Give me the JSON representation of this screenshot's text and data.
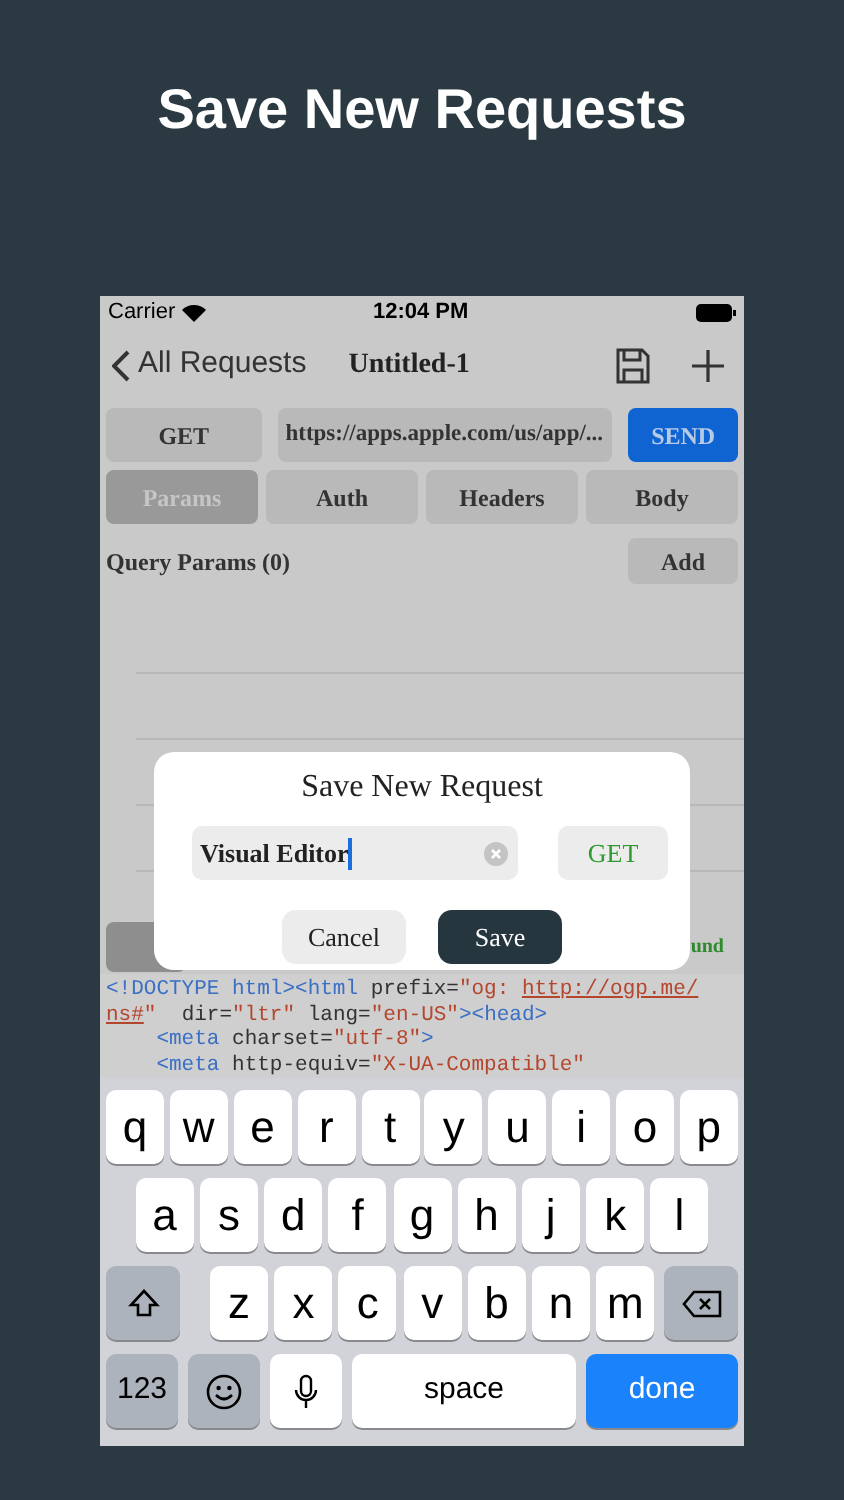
{
  "headline": "Save New Requests",
  "status_bar": {
    "carrier": "Carrier",
    "time": "12:04 PM"
  },
  "nav": {
    "back": "All Requests",
    "title": "Untitled-1"
  },
  "request": {
    "method": "GET",
    "url": "https://apps.apple.com/us/app/...",
    "send": "SEND"
  },
  "tabs": [
    {
      "label": "Params",
      "selected": true
    },
    {
      "label": "Auth",
      "selected": false
    },
    {
      "label": "Headers",
      "selected": false
    },
    {
      "label": "Body",
      "selected": false
    }
  ],
  "query_params": {
    "label": "Query Params (0)",
    "add": "Add"
  },
  "partial_status": "und",
  "code_lines": [
    [
      {
        "kind": "tag",
        "text": "<!DOCTYPE html><html "
      },
      {
        "kind": "attr",
        "text": "prefix="
      },
      {
        "kind": "value",
        "text": "\"og: "
      },
      {
        "kind": "link",
        "text": "http://ogp.me/"
      }
    ],
    [
      {
        "kind": "link",
        "text": "ns#"
      },
      {
        "kind": "value",
        "text": "\""
      },
      {
        "kind": "attr",
        "text": "  dir="
      },
      {
        "kind": "value",
        "text": "\"ltr\""
      },
      {
        "kind": "attr",
        "text": " lang="
      },
      {
        "kind": "value",
        "text": "\"en-US\""
      },
      {
        "kind": "tag",
        "text": "><head>"
      }
    ],
    [
      {
        "kind": "tag",
        "text": "    <meta "
      },
      {
        "kind": "attr",
        "text": "charset="
      },
      {
        "kind": "value",
        "text": "\"utf-8\""
      },
      {
        "kind": "tag",
        "text": ">"
      }
    ],
    [
      {
        "kind": "tag",
        "text": "    <meta "
      },
      {
        "kind": "attr",
        "text": "http-equiv="
      },
      {
        "kind": "value",
        "text": "\"X-UA-Compatible\""
      }
    ]
  ],
  "dialog": {
    "title": "Save New Request",
    "name_value": "Visual Editor",
    "method": "GET",
    "cancel": "Cancel",
    "save": "Save"
  },
  "keyboard": {
    "rows": [
      [
        "q",
        "w",
        "e",
        "r",
        "t",
        "y",
        "u",
        "i",
        "o",
        "p"
      ],
      [
        "a",
        "s",
        "d",
        "f",
        "g",
        "h",
        "j",
        "k",
        "l"
      ],
      [
        "z",
        "x",
        "c",
        "v",
        "b",
        "n",
        "m"
      ]
    ],
    "numbers": "123",
    "space": "space",
    "done": "done"
  }
}
